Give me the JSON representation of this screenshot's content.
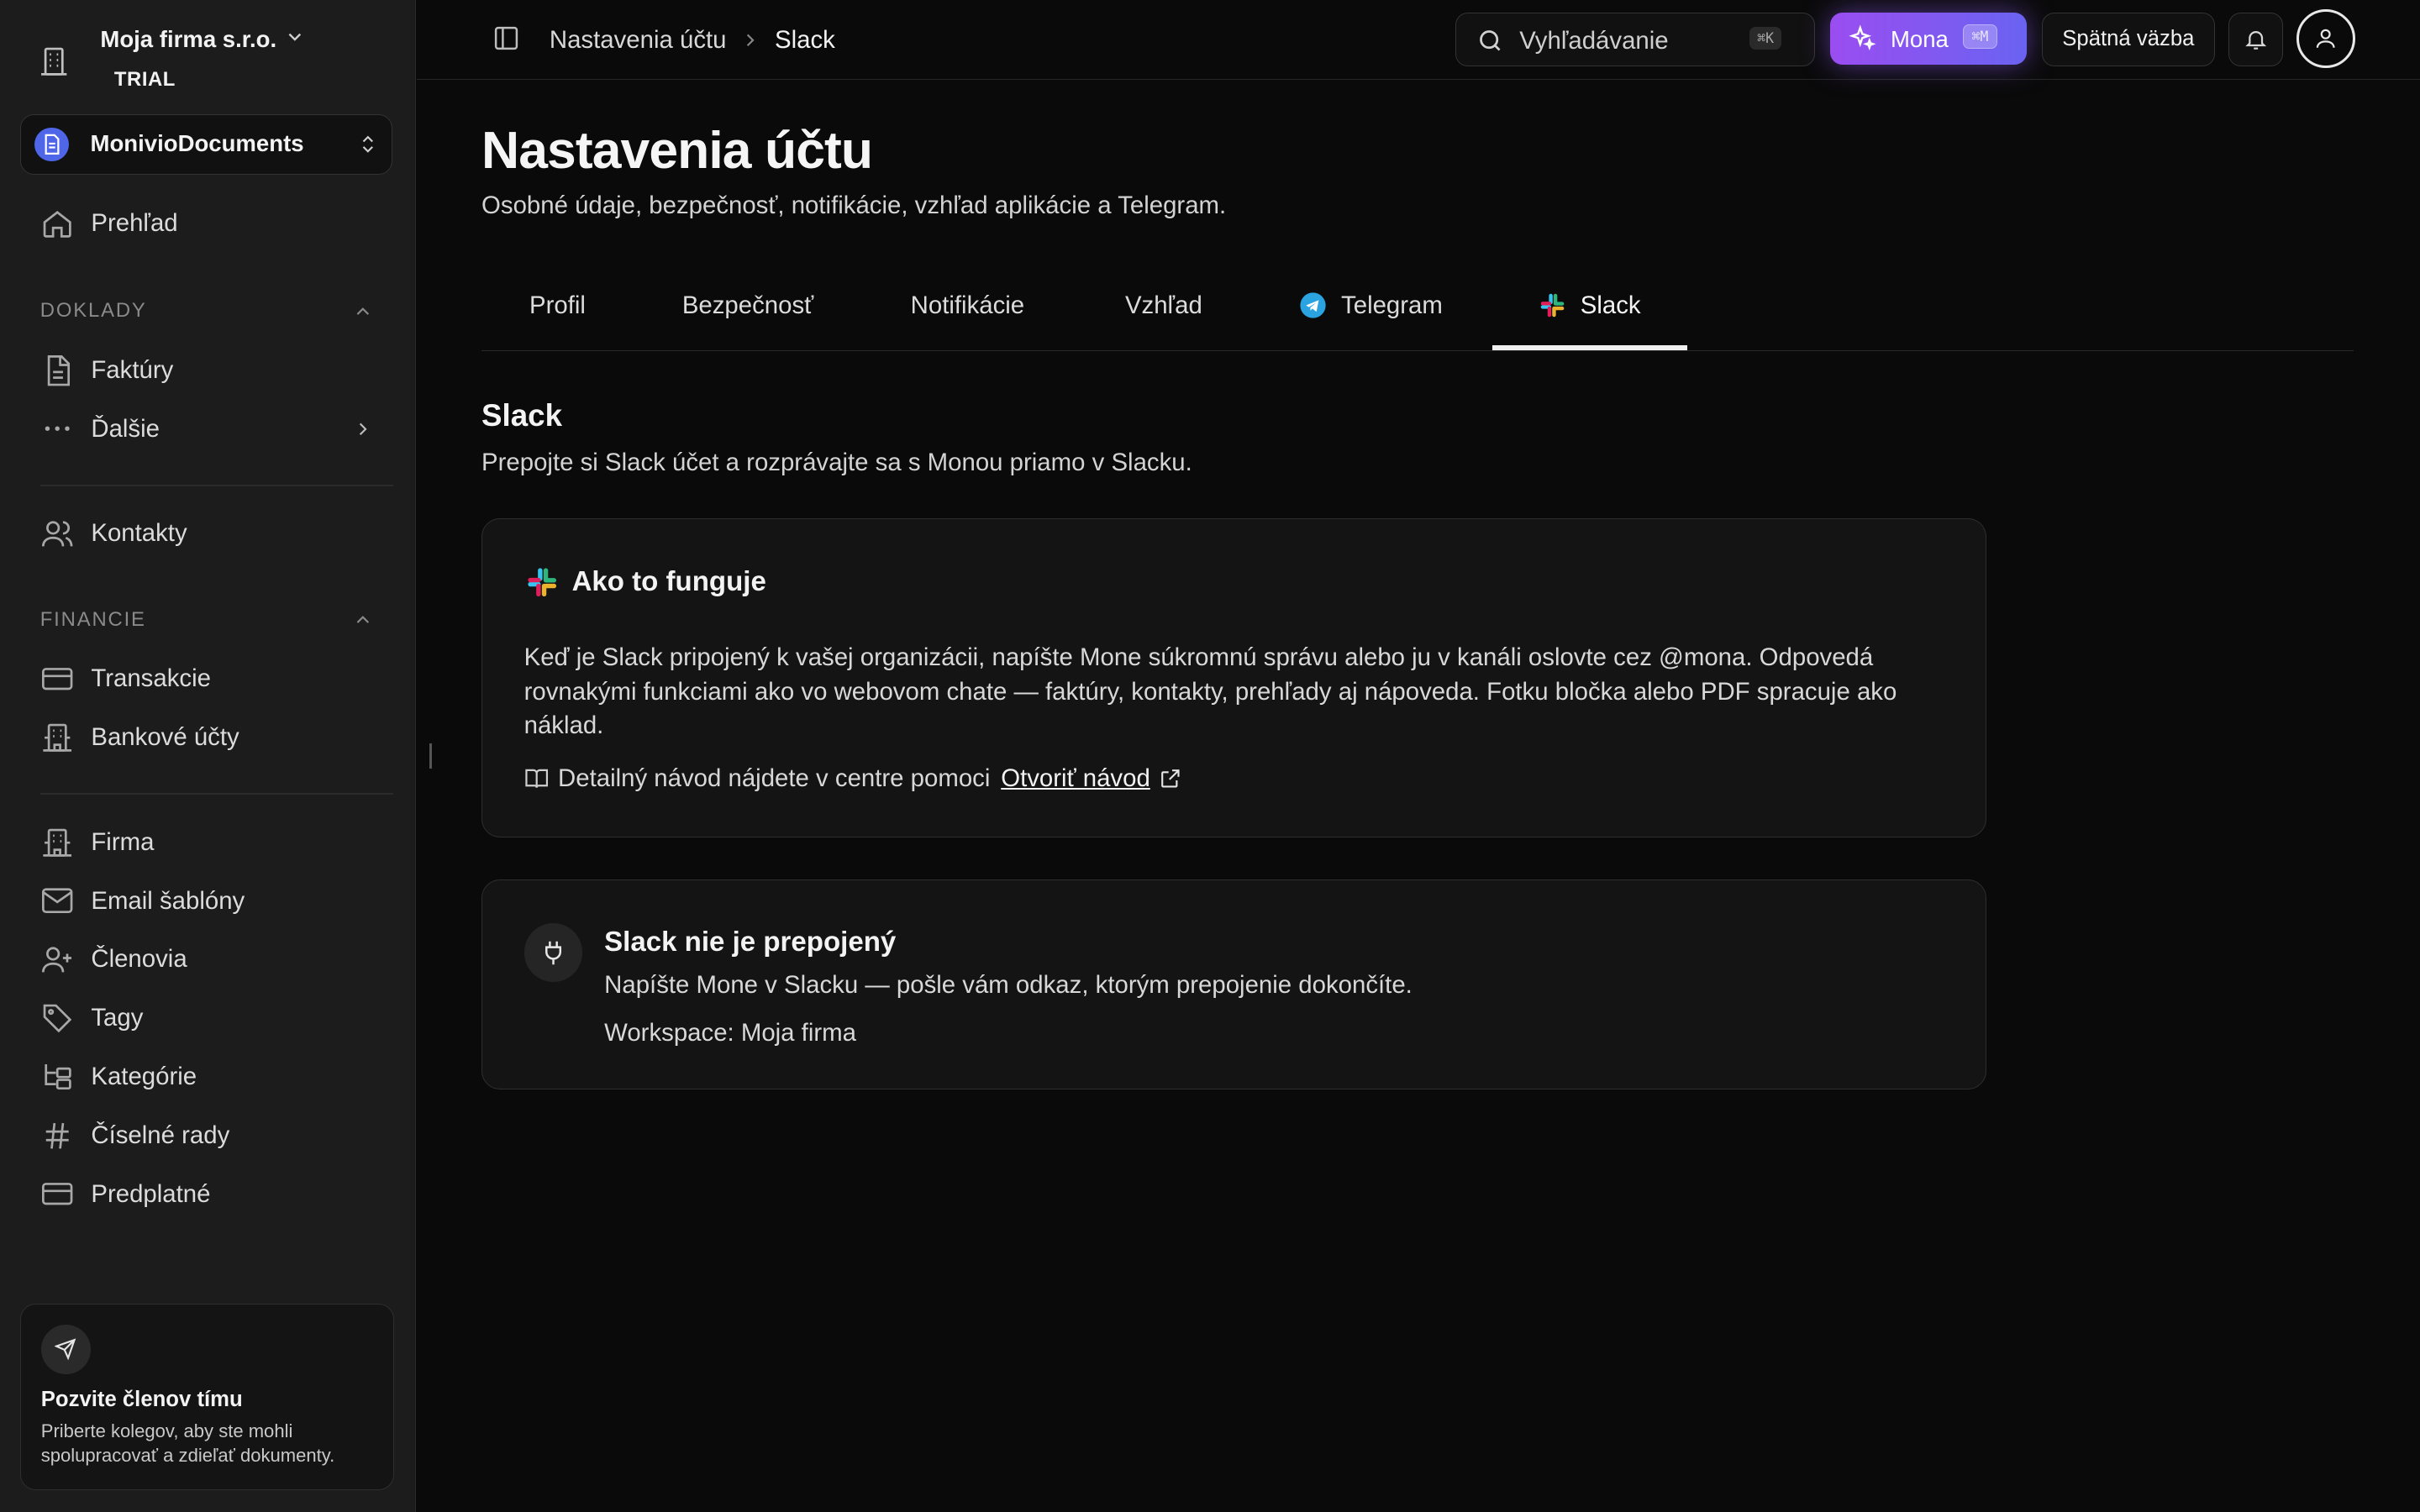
{
  "sidebar": {
    "org_name": "Moja firma s.r.o.",
    "plan": "TRIAL",
    "workspace": "MonivioDocuments",
    "overview": "Prehľad",
    "section_documents": "DOKLADY",
    "invoices": "Faktúry",
    "more": "Ďalšie",
    "contacts": "Kontakty",
    "section_finance": "FINANCIE",
    "transactions": "Transakcie",
    "bank_accounts": "Bankové účty",
    "company": "Firma",
    "email_templates": "Email šablóny",
    "members": "Členovia",
    "tags": "Tagy",
    "categories": "Kategórie",
    "number_series": "Číselné rady",
    "subscription": "Predplatné",
    "invite_title": "Pozvite členov tímu",
    "invite_desc": "Priberte kolegov, aby ste mohli spolupracovať a zdieľať dokumenty."
  },
  "header": {
    "breadcrumb_parent": "Nastavenia účtu",
    "breadcrumb_current": "Slack",
    "search_placeholder": "Vyhľadávanie",
    "search_shortcut": "⌘K",
    "mona_label": "Mona",
    "mona_shortcut": "⌘M",
    "feedback_label": "Spätná väzba"
  },
  "page": {
    "title": "Nastavenia účtu",
    "subtitle": "Osobné údaje, bezpečnosť, notifikácie, vzhľad aplikácie a Telegram.",
    "tabs": {
      "profile": "Profil",
      "security": "Bezpečnosť",
      "notifications": "Notifikácie",
      "appearance": "Vzhľad",
      "telegram": "Telegram",
      "slack": "Slack"
    },
    "active_tab": "Slack"
  },
  "slack": {
    "title": "Slack",
    "subtitle": "Prepojte si Slack účet a rozprávajte sa s Monou priamo v Slacku.",
    "how_title": "Ako to funguje",
    "how_body": "Keď je Slack pripojený k vašej organizácii, napíšte Mone súkromnú správu alebo ju v kanáli oslovte cez @mona. Odpovedá rovnakými funkciami ako vo webovom chate — faktúry, kontakty, prehľady aj nápoveda. Fotku bločka alebo PDF spracuje ako náklad.",
    "help_text": "Detailný návod nájdete v centre pomoci",
    "help_link": "Otvoriť návod",
    "status_title": "Slack nie je prepojený",
    "status_desc": "Napíšte Mone v Slacku — pošle vám odkaz, ktorým prepojenie dokončíte.",
    "workspace": "Workspace: Moja firma"
  },
  "colors": {
    "accent_start": "#9a4df0",
    "accent_end": "#6a63f2",
    "workspace_badge": "#4f66e8",
    "telegram": "#2aa3e0"
  }
}
